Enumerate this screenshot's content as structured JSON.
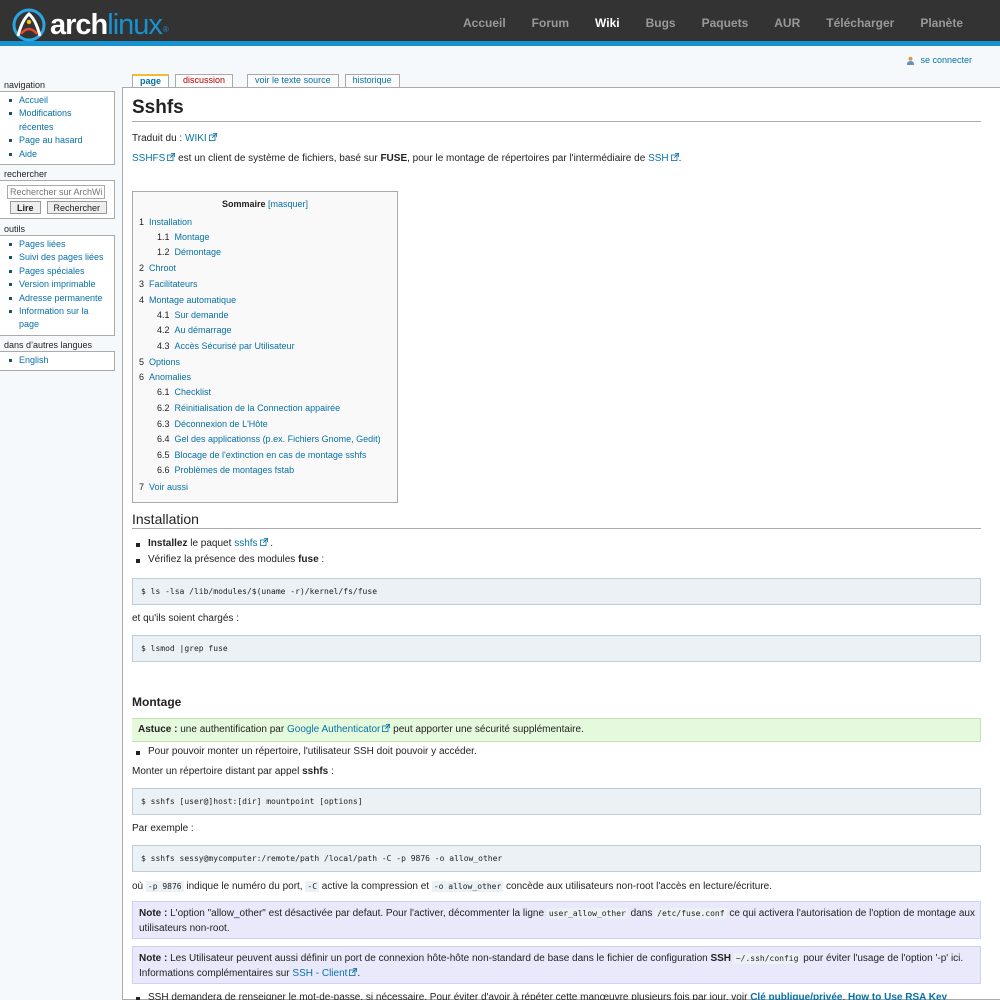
{
  "header": {
    "logo_part1": "arch",
    "logo_part2": "linux",
    "logo_reg": "®",
    "nav": [
      "Accueil",
      "Forum",
      "Wiki",
      "Bugs",
      "Paquets",
      "AUR",
      "Télécharger",
      "Planète"
    ],
    "selected_nav": "Wiki",
    "colors": {
      "bar": "#333333",
      "accent": "#1793d1"
    }
  },
  "personal": {
    "login": "se connecter"
  },
  "sidebar": {
    "navigation": {
      "title": "navigation",
      "items": [
        "Accueil",
        "Modifications",
        "récentes",
        "Page au hasard",
        "Aide"
      ]
    },
    "search": {
      "title": "rechercher",
      "placeholder": "Rechercher sur ArchWiki",
      "go": "Lire",
      "search": "Rechercher"
    },
    "tools": {
      "title": "outils",
      "items": [
        "Pages liées",
        "Suivi des pages liées",
        "Pages spéciales",
        "Version imprimable",
        "Adresse permanente",
        "Information sur la",
        "page"
      ]
    },
    "languages": {
      "title": "dans d’autres langues",
      "items": [
        "English"
      ]
    }
  },
  "tabs": [
    "page",
    "discussion",
    "voir le texte source",
    "historique"
  ],
  "page": {
    "title": "Sshfs",
    "translated_label": "Traduit du :",
    "translated_link": "WIKI",
    "intro": {
      "link1": "SSHFS",
      "text1": " est un client de système de fichiers, basé sur ",
      "bold": "FUSE",
      "text2": ", pour le montage de répertoires par l'intermédiaire de ",
      "link2": "SSH",
      "text3": "."
    },
    "toc": {
      "title": "Sommaire",
      "toggle": "[masquer]",
      "items": [
        {
          "num": "1",
          "label": "Installation"
        },
        {
          "num": "1.1",
          "label": "Montage"
        },
        {
          "num": "1.2",
          "label": "Démontage"
        },
        {
          "num": "2",
          "label": "Chroot"
        },
        {
          "num": "3",
          "label": "Facilitateurs"
        },
        {
          "num": "4",
          "label": "Montage automatique"
        },
        {
          "num": "4.1",
          "label": "Sur demande"
        },
        {
          "num": "4.2",
          "label": "Au démarrage"
        },
        {
          "num": "4.3",
          "label": "Accès Sécurisé par Utilisateur"
        },
        {
          "num": "5",
          "label": "Options"
        },
        {
          "num": "6",
          "label": "Anomalies"
        },
        {
          "num": "6.1",
          "label": "Checklist"
        },
        {
          "num": "6.2",
          "label": "Réinitialisation de la Connection appairée"
        },
        {
          "num": "6.3",
          "label": "Déconnexion de L'Hôte"
        },
        {
          "num": "6.4",
          "label": "Gel des applicationss (p.ex. Fichiers Gnome, Gedit)"
        },
        {
          "num": "6.5",
          "label": "Blocage de l'extinction en cas de montage sshfs"
        },
        {
          "num": "6.6",
          "label": "Problèmes de montages fstab"
        },
        {
          "num": "7",
          "label": "Voir aussi"
        }
      ]
    },
    "installation": {
      "heading": "Installation",
      "b1_bold": "Installez",
      "b1_text": " le paquet ",
      "b1_link": "sshfs",
      "b1_end": " .",
      "b2_text": "Vérifiez la présence des modules ",
      "b2_bold": "fuse",
      "b2_end": " :",
      "code1": "$ ls -lsa /lib/modules/$(uname -r)/kernel/fs/fuse",
      "text_loaded": "et qu'ils soient chargés :",
      "code2": "$ lsmod |grep fuse"
    },
    "montage": {
      "heading": "Montage",
      "tip_label": "Astuce :",
      "tip_text1": " une authentification par ",
      "tip_link": "Google Authenticator",
      "tip_text2": " peut apporter une sécurité supplémentaire.",
      "bullet1": "Pour pouvoir monter un répertoire, l'utilisateur SSH doit pouvoir y accéder.",
      "line1_text": "Monter un répertoire distant par appel ",
      "line1_bold": "sshfs",
      "line1_end": " :",
      "code3": "$ sshfs [user@]host:[dir] mountpoint [options]",
      "example_label": "Par exemple :",
      "code4": "$ sshfs sessy@mycomputer:/remote/path /local/path -C -p 9876 -o allow_other",
      "explain": {
        "t1": "où ",
        "c1": "-p 9876",
        "t2": " indique le numéro du port, ",
        "c2": "-C",
        "t3": " active la compression et ",
        "c3": "-o allow_other",
        "t4": " concède aux utilisateurs non-root l'accès en lecture/écriture."
      },
      "note1": {
        "label": "Note :",
        "t1": " L'option \"allow_other\" est désactivée par defaut. Pour l'activer, décommenter la ligne ",
        "c1": "user_allow_other",
        "t2": " dans ",
        "c2": "/etc/fuse.conf",
        "t3": " ce qui activera l'autorisation de l'option de montage aux",
        "t4": "utilisateurs non-root."
      },
      "note2": {
        "label": "Note :",
        "t1": " Les Utilisateur peuvent aussi définir un port de connexion hôte-hôte non-standard de base dans le fichier de configuration ",
        "b1": "SSH",
        "c1": "~/.ssh/config",
        "t2": " pour éviter l'usage de l'option '-p' ici.",
        "t3": "Informations complémentaires sur ",
        "link": "SSH - Client",
        "t4": "."
      },
      "last_bullet": {
        "t1": "SSH demandera de renseigner le mot-de-passe, si nécessaire. Pour éviter d'avoir à répéter cette manœuvre plusieurs fois par jour, voir ",
        "link1": "Clé publique/privée",
        "t2": ". ",
        "link2": "How to Use RSA Key"
      }
    }
  }
}
